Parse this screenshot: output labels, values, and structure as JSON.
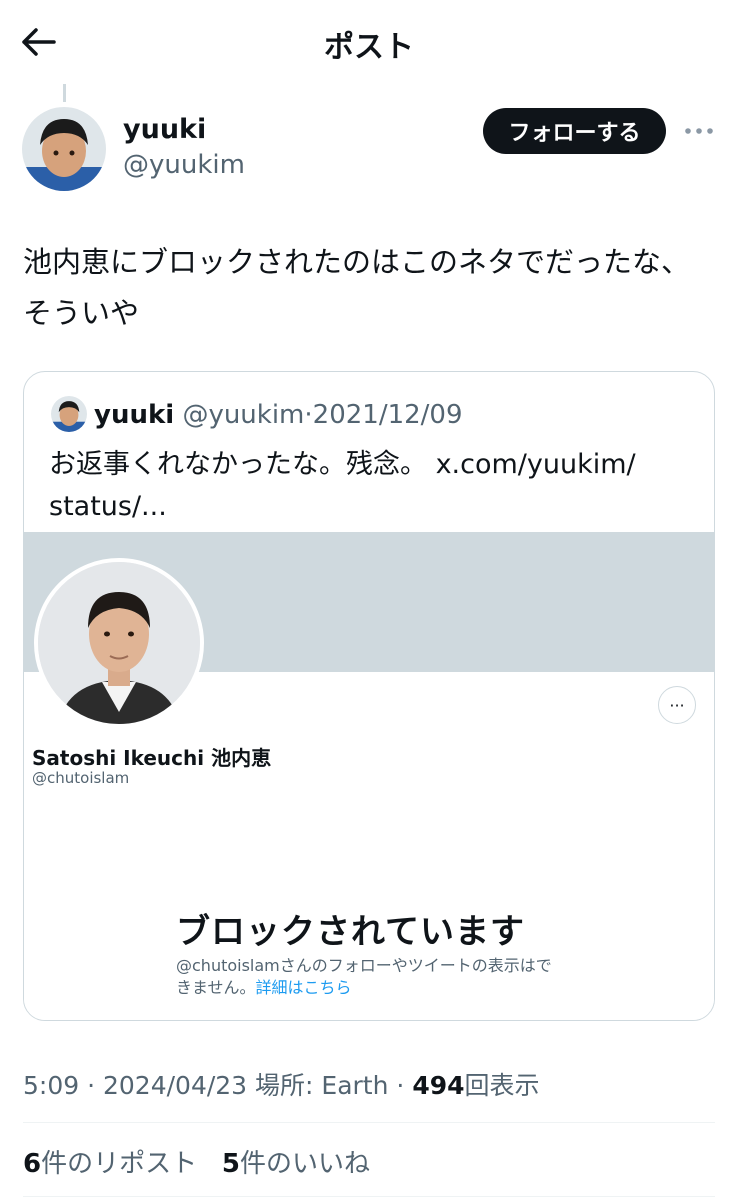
{
  "header": {
    "title": "ポスト",
    "back_icon": "arrow-left-icon"
  },
  "post": {
    "author_name": "yuuki",
    "author_handle": "@yuukim",
    "follow_label": "フォローする",
    "more_icon": "more-horizontal-icon",
    "text_line1": "池内恵にブロックされたのはこのネタでだったな、",
    "text_line2": "そういや"
  },
  "quote": {
    "author_name": "yuuki",
    "author_handle": "@yuukim",
    "separator": "·",
    "date": "2021/12/09",
    "text_line1": "お返事くれなかったな。残念。 x.com/yuukim/",
    "text_line2": "status/...",
    "screenshot": {
      "name_en": "Satoshi Ikeuchi",
      "name_jp": "池内恵",
      "handle": "@chutoislam",
      "more_label": "···",
      "blocked_title": "ブロックされています",
      "blocked_desc_line1": "@chutoislamさんのフォローやツイートの表示はで",
      "blocked_desc_line2": "きません。",
      "learn_more": "詳細はこちら"
    }
  },
  "meta": {
    "time": "5:09",
    "sep": "·",
    "date": "2024/04/23",
    "location": "場所: Earth",
    "views_count": "494",
    "views_label": "回表示"
  },
  "stats": {
    "reposts_count": "6",
    "reposts_label": "件のリポスト",
    "likes_count": "5",
    "likes_label": "件のいいね"
  },
  "colors": {
    "text": "#0f1419",
    "secondary": "#536471",
    "border": "#cfd9de",
    "link": "#1d9bf0"
  }
}
